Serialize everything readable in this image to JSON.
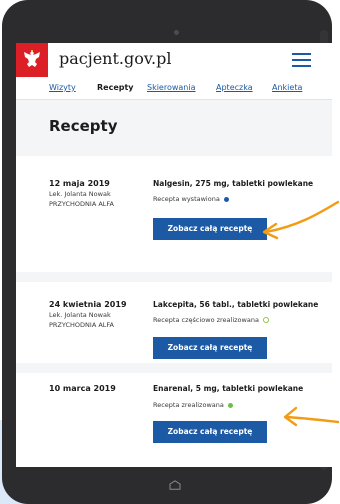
{
  "site": {
    "name": "pacjent.gov.pl"
  },
  "icons": {
    "logo": "polish-eagle-icon",
    "menu": "hamburger-menu-icon",
    "home": "home-icon"
  },
  "colors": {
    "brand_red": "#dc1f26",
    "primary_blue": "#1d5aa5",
    "status_issued": "#1d5aa5",
    "status_partial": "#8ec63f",
    "status_done": "#6cc04a",
    "annotation": "#f39b12"
  },
  "tabs": [
    {
      "label": "Wizyty",
      "active": false
    },
    {
      "label": "Recepty",
      "active": true
    },
    {
      "label": "Skierowania",
      "active": false
    },
    {
      "label": "Apteczka",
      "active": false
    },
    {
      "label": "Ankieta",
      "active": false
    }
  ],
  "page_title": "Recepty",
  "prescriptions": [
    {
      "date": "12 maja 2019",
      "doctor": "Lek. Jolanta Nowak",
      "clinic": "PRZYCHODNIA ALFA",
      "drug": "Nalgesin, 275 mg, tabletki powlekane",
      "status": "Recepta wystawiona",
      "button": "Zobacz całą receptę"
    },
    {
      "date": "24 kwietnia 2019",
      "doctor": "Lek. Jolanta Nowak",
      "clinic": "PRZYCHODNIA ALFA",
      "drug": "Lakcepita, 56 tabl., tabletki powlekane",
      "status": "Recepta częściowo zrealizowana",
      "button": "Zobacz całą receptę"
    },
    {
      "date": "10 marca 2019",
      "drug": "Enarenal, 5 mg, tabletki powlekane",
      "status": "Recepta zrealizowana",
      "button": "Zobacz całą receptę"
    }
  ]
}
